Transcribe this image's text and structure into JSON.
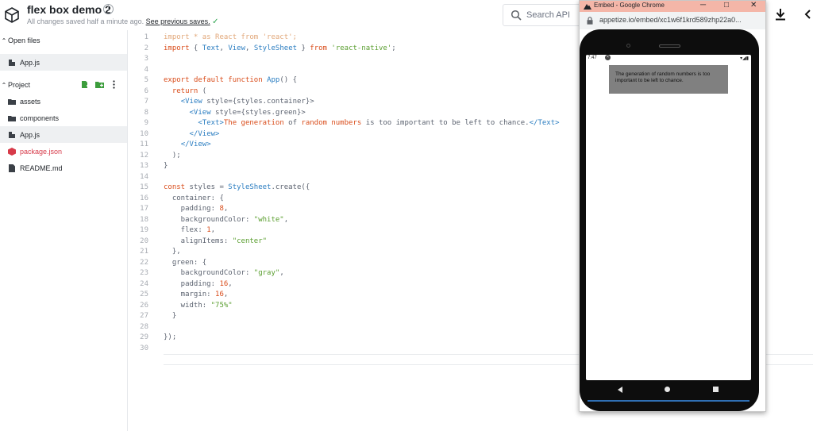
{
  "header": {
    "title": "flex box demo 2",
    "saved_text": "All changes saved half a minute ago.",
    "saved_link": "See previous saves.",
    "check": "✓",
    "search_placeholder": "Search API"
  },
  "sidebar": {
    "open_files_label": "Open files",
    "open_files": [
      {
        "name": "App.js"
      }
    ],
    "project_label": "Project",
    "project_items": [
      {
        "name": "assets",
        "type": "folder"
      },
      {
        "name": "components",
        "type": "folder"
      },
      {
        "name": "App.js",
        "type": "file-js"
      },
      {
        "name": "package.json",
        "type": "file-pkg"
      },
      {
        "name": "README.md",
        "type": "file-md"
      }
    ]
  },
  "editor": {
    "lines": [
      [
        [
          "import * as React from 'react';",
          "dim"
        ]
      ],
      [
        [
          "import",
          "kw"
        ],
        [
          " { ",
          "pl"
        ],
        [
          "Text",
          "id"
        ],
        [
          ", ",
          "pl"
        ],
        [
          "View",
          "id"
        ],
        [
          ", ",
          "pl"
        ],
        [
          "StyleSheet",
          "id"
        ],
        [
          " } ",
          "pl"
        ],
        [
          "from",
          "kw"
        ],
        [
          " ",
          "pl"
        ],
        [
          "'react-native'",
          "str"
        ],
        [
          ";",
          "pl"
        ]
      ],
      [],
      [],
      [
        [
          "export",
          "kw"
        ],
        [
          " ",
          "pl"
        ],
        [
          "default",
          "kw"
        ],
        [
          " ",
          "pl"
        ],
        [
          "function",
          "kw"
        ],
        [
          " ",
          "pl"
        ],
        [
          "App",
          "id"
        ],
        [
          "() {",
          "pl"
        ]
      ],
      [
        [
          "  ",
          "pl"
        ],
        [
          "return",
          "kw"
        ],
        [
          " (",
          "pl"
        ]
      ],
      [
        [
          "    ",
          "pl"
        ],
        [
          "<View",
          "id"
        ],
        [
          " style={styles.container}>",
          "pl"
        ]
      ],
      [
        [
          "      ",
          "pl"
        ],
        [
          "<View",
          "id"
        ],
        [
          " style={styles.green}>",
          "pl"
        ]
      ],
      [
        [
          "        ",
          "pl"
        ],
        [
          "<Text>",
          "id"
        ],
        [
          "The generation ",
          "kw"
        ],
        [
          "of",
          "pl"
        ],
        [
          " random numbers ",
          "kw"
        ],
        [
          "is too important to be left to chance.",
          "pl"
        ],
        [
          "</Text>",
          "id"
        ]
      ],
      [
        [
          "      ",
          "pl"
        ],
        [
          "</View>",
          "id"
        ]
      ],
      [
        [
          "    ",
          "pl"
        ],
        [
          "</View>",
          "id"
        ]
      ],
      [
        [
          "  );",
          "pl"
        ]
      ],
      [
        [
          "}",
          "pl"
        ]
      ],
      [],
      [
        [
          "const",
          "kw"
        ],
        [
          " styles = ",
          "pl"
        ],
        [
          "StyleSheet",
          "id"
        ],
        [
          ".create({",
          "pl"
        ]
      ],
      [
        [
          "  container: {",
          "pl"
        ]
      ],
      [
        [
          "    padding: ",
          "pl"
        ],
        [
          "8",
          "num"
        ],
        [
          ",",
          "pl"
        ]
      ],
      [
        [
          "    backgroundColor: ",
          "pl"
        ],
        [
          "\"white\"",
          "str"
        ],
        [
          ",",
          "pl"
        ]
      ],
      [
        [
          "    flex: ",
          "pl"
        ],
        [
          "1",
          "num"
        ],
        [
          ",",
          "pl"
        ]
      ],
      [
        [
          "    alignItems: ",
          "pl"
        ],
        [
          "\"center\"",
          "str"
        ]
      ],
      [
        [
          "  },",
          "pl"
        ]
      ],
      [
        [
          "  green: {",
          "pl"
        ]
      ],
      [
        [
          "    backgroundColor: ",
          "pl"
        ],
        [
          "\"gray\"",
          "str"
        ],
        [
          ",",
          "pl"
        ]
      ],
      [
        [
          "    padding: ",
          "pl"
        ],
        [
          "16",
          "num"
        ],
        [
          ",",
          "pl"
        ]
      ],
      [
        [
          "    margin: ",
          "pl"
        ],
        [
          "16",
          "num"
        ],
        [
          ",",
          "pl"
        ]
      ],
      [
        [
          "    width: ",
          "pl"
        ],
        [
          "\"75%\"",
          "str"
        ]
      ],
      [
        [
          "  }",
          "pl"
        ]
      ],
      [],
      [
        [
          "});",
          "pl"
        ]
      ],
      []
    ]
  },
  "popup": {
    "window_title": "Embed - Google Chrome",
    "url": "appetize.io/embed/xc1w6f1krd589zhp22a0...",
    "minimize": "─",
    "maximize": "□",
    "close": "✕"
  },
  "phone": {
    "time": "7:47",
    "signal": "▾◢▮",
    "app_text": "The generation of random numbers is too important to be left to chance."
  },
  "colors": {
    "keyword": "#d94c1a",
    "string": "#5a9e2f",
    "identifier": "#2a7dc1",
    "popup_titlebar": "#f4b6a8",
    "gray_box": "#808080"
  }
}
